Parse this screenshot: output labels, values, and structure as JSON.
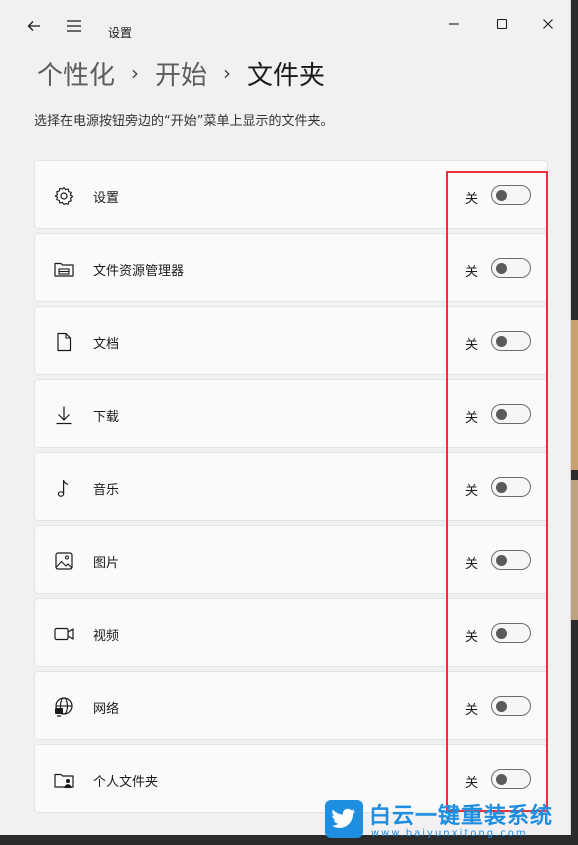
{
  "window": {
    "app_title": "设置",
    "controls": {
      "minimize": "minimize-icon",
      "maximize": "maximize-icon",
      "close": "close-icon"
    }
  },
  "breadcrumb": {
    "items": [
      "个性化",
      "开始",
      "文件夹"
    ],
    "separator": "›"
  },
  "description": "选择在电源按钮旁边的“开始”菜单上显示的文件夹。",
  "folders": [
    {
      "label": "设置",
      "state": "关",
      "icon": "gear-icon",
      "on": false
    },
    {
      "label": "文件资源管理器",
      "state": "关",
      "icon": "file-explorer-icon",
      "on": false
    },
    {
      "label": "文档",
      "state": "关",
      "icon": "document-icon",
      "on": false
    },
    {
      "label": "下载",
      "state": "关",
      "icon": "download-icon",
      "on": false
    },
    {
      "label": "音乐",
      "state": "关",
      "icon": "music-icon",
      "on": false
    },
    {
      "label": "图片",
      "state": "关",
      "icon": "picture-icon",
      "on": false
    },
    {
      "label": "视频",
      "state": "关",
      "icon": "video-icon",
      "on": false
    },
    {
      "label": "网络",
      "state": "关",
      "icon": "network-icon",
      "on": false
    },
    {
      "label": "个人文件夹",
      "state": "关",
      "icon": "personal-folder-icon",
      "on": false
    }
  ],
  "colors": {
    "highlight": "#e8333f",
    "watermark": "#1d8ee0"
  },
  "watermark": {
    "text": "白云一键重装系统",
    "url": "www.baiyunxitong.com",
    "icon": "twitter-bird-icon"
  }
}
